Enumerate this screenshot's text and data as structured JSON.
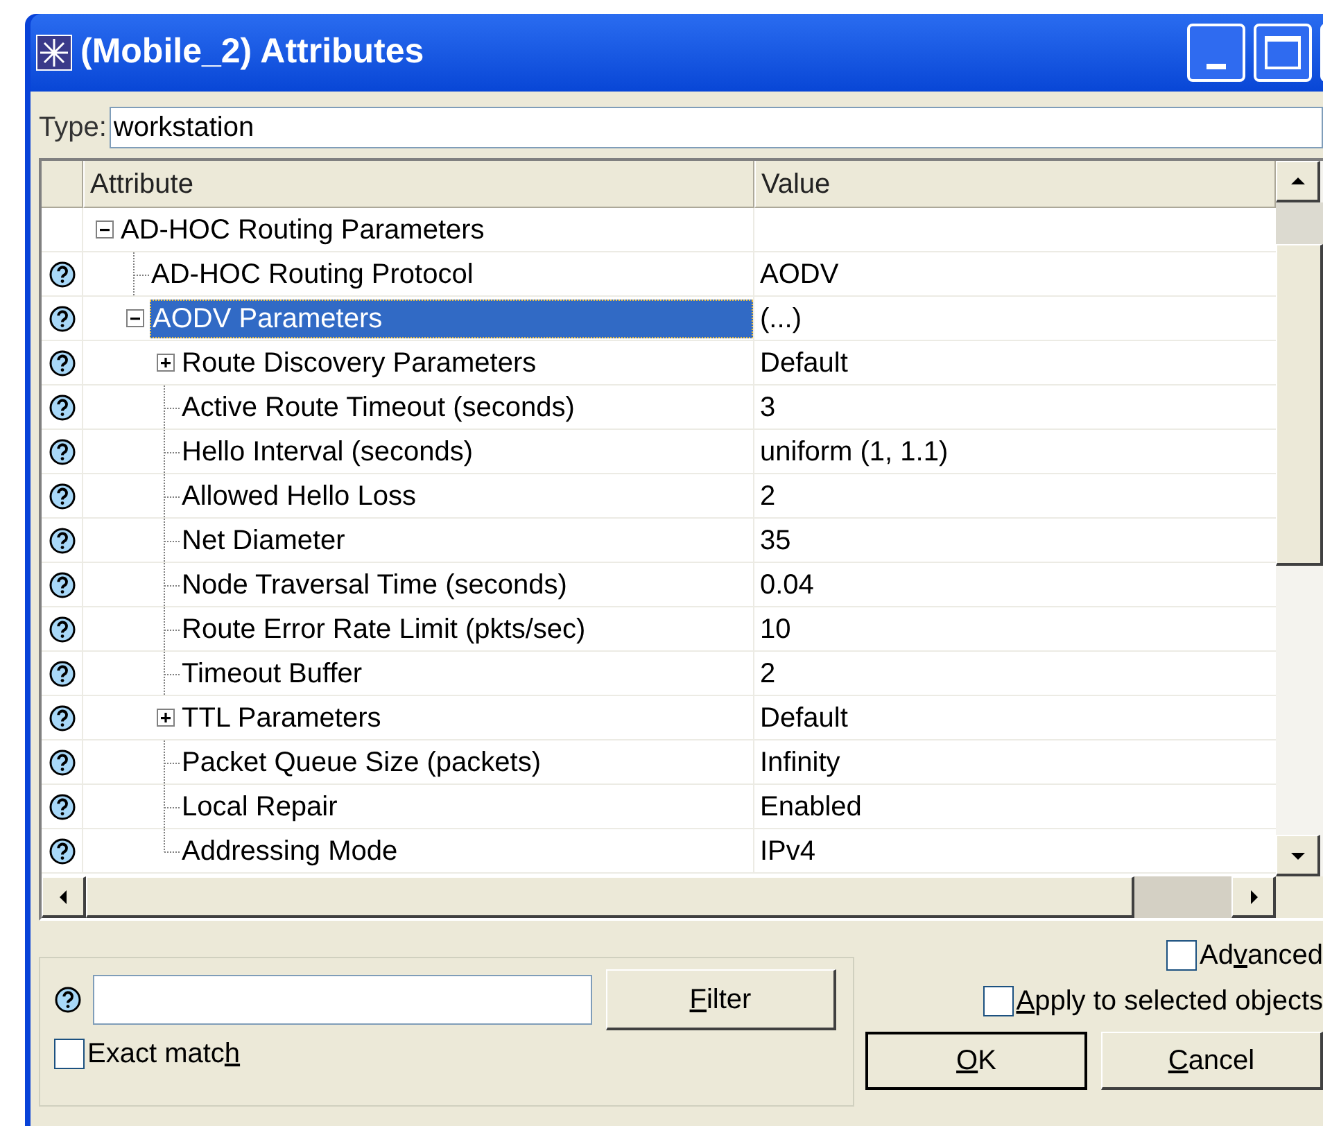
{
  "window": {
    "title": "(Mobile_2) Attributes"
  },
  "type_field": {
    "label": "Type:",
    "value": "workstation"
  },
  "table": {
    "columns": [
      "Attribute",
      "Value"
    ],
    "rows": [
      {
        "name": "AD-HOC Routing Parameters",
        "help": false,
        "expanded": true,
        "selected": false,
        "children": [
          {
            "name": "AD-HOC Routing Protocol",
            "value": "AODV",
            "help": true,
            "selected": false
          },
          {
            "name": "AODV Parameters",
            "value": "(...)",
            "help": true,
            "expanded": true,
            "selected": true,
            "children": [
              {
                "name": "Route Discovery Parameters",
                "value": "Default",
                "help": true,
                "expanded": false,
                "selected": false
              },
              {
                "name": "Active Route Timeout (seconds)",
                "value": "3",
                "help": true,
                "selected": false
              },
              {
                "name": "Hello Interval (seconds)",
                "value": "uniform (1, 1.1)",
                "help": true,
                "selected": false
              },
              {
                "name": "Allowed Hello Loss",
                "value": "2",
                "help": true,
                "selected": false
              },
              {
                "name": "Net Diameter",
                "value": "35",
                "help": true,
                "selected": false
              },
              {
                "name": "Node Traversal Time (seconds)",
                "value": "0.04",
                "help": true,
                "selected": false
              },
              {
                "name": "Route Error Rate Limit (pkts/sec)",
                "value": "10",
                "help": true,
                "selected": false
              },
              {
                "name": "Timeout Buffer",
                "value": "2",
                "help": true,
                "selected": false
              },
              {
                "name": "TTL Parameters",
                "value": "Default",
                "help": true,
                "expanded": false,
                "selected": false
              },
              {
                "name": "Packet Queue Size (packets)",
                "value": "Infinity",
                "help": true,
                "selected": false
              },
              {
                "name": "Local Repair",
                "value": "Enabled",
                "help": true,
                "selected": false
              },
              {
                "name": "Addressing Mode",
                "value": "IPv4",
                "help": true,
                "selected": false
              }
            ]
          }
        ]
      }
    ]
  },
  "filter": {
    "button": {
      "key": "F",
      "after": "ilter"
    },
    "exact_match": {
      "before": "Exact matc",
      "key": "h",
      "checked": false
    }
  },
  "advanced": {
    "before": "Ad",
    "key": "v",
    "after": "anced",
    "checked": false
  },
  "apply_to_selected": {
    "key": "A",
    "after": "pply to selected objects",
    "checked": false
  },
  "buttons": [
    {
      "key": "O",
      "after": "K"
    },
    {
      "key": "C",
      "after": "ancel"
    }
  ]
}
